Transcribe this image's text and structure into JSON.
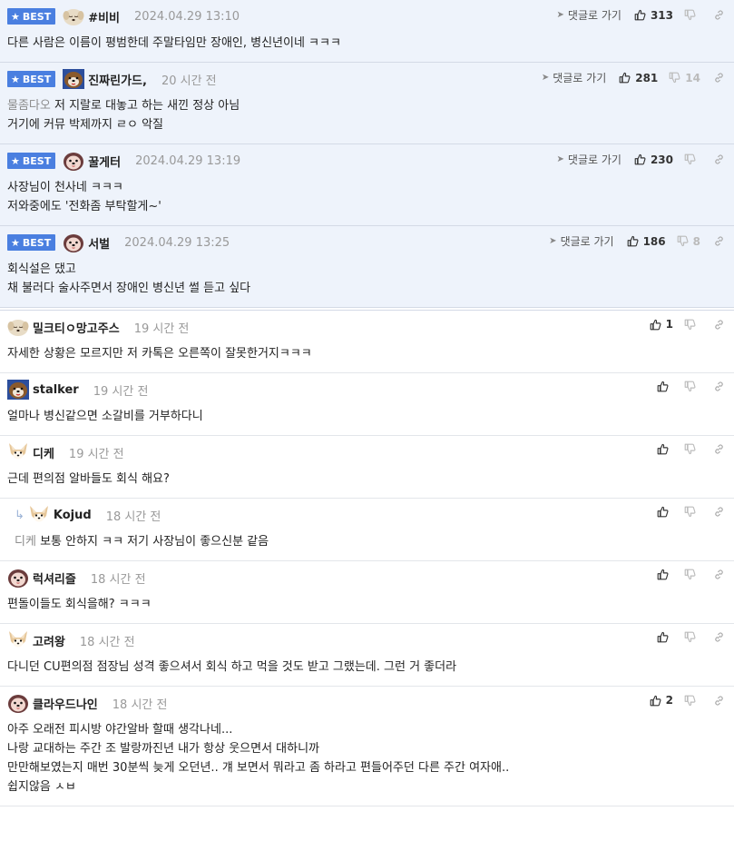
{
  "labels": {
    "best": "BEST",
    "go_reply": "댓글로 가기"
  },
  "colors": {
    "best_bg": "#eef3fb",
    "badge": "#4a7fe0"
  },
  "best_comments": [
    {
      "nick": "#비비",
      "time": "2024.04.29 13:10",
      "likes": "313",
      "dislikes": "",
      "avatar": "sleepy-dog",
      "lines": [
        "다른 사람은 이름이 평범한데 주말타임만 장애인, 병신년이네 ㅋㅋㅋ"
      ]
    },
    {
      "nick": "진짜린가드,",
      "time": "20 시간 전",
      "likes": "281",
      "dislikes": "14",
      "avatar": "brown-dog",
      "mention": "물좀다오",
      "lines": [
        "저 지랄로 대놓고 하는 새낀 정상 아님",
        "거기에 커뮤 박제까지 ㄹㅇ 악질"
      ]
    },
    {
      "nick": "꿀게터",
      "time": "2024.04.29 13:19",
      "likes": "230",
      "dislikes": "",
      "avatar": "pink-dog",
      "lines": [
        "사장님이 천사네 ㅋㅋㅋ",
        "저와중에도 '전화좀 부탁할게~'"
      ]
    },
    {
      "nick": "서벌",
      "time": "2024.04.29 13:25",
      "likes": "186",
      "dislikes": "8",
      "avatar": "pink-dog",
      "lines": [
        "회식설은 댔고",
        "채 불러다 술사주면서 장애인 병신년 썰 듣고 싶다"
      ]
    }
  ],
  "comments": [
    {
      "nick": "밀크티ㅇ망고주스",
      "time": "19 시간 전",
      "likes": "1",
      "avatar": "sleepy-dog",
      "lines": [
        "자세한 상황은 모르지만 저 카톡은 오른쪽이 잘못한거지ㅋㅋㅋ"
      ]
    },
    {
      "nick": "stalker",
      "time": "19 시간 전",
      "likes": "",
      "avatar": "brown-dog",
      "lines": [
        "얼마나 병신같으면 소갈비를 거부하다니"
      ]
    },
    {
      "nick": "디케",
      "time": "19 시간 전",
      "likes": "",
      "avatar": "fennec",
      "lines": [
        "근데 편의점 알바들도 회식 해요?"
      ]
    },
    {
      "nick": "Kojud",
      "time": "18 시간 전",
      "likes": "",
      "avatar": "fennec",
      "reply": true,
      "mention": "디케",
      "lines": [
        "보통 안하지 ㅋㅋ 저기 사장님이 좋으신분 같음"
      ]
    },
    {
      "nick": "럭셔리즐",
      "time": "18 시간 전",
      "likes": "",
      "avatar": "pink-dog",
      "lines": [
        "편돌이들도 회식을해? ㅋㅋㅋ"
      ]
    },
    {
      "nick": "고려왕",
      "time": "18 시간 전",
      "likes": "",
      "avatar": "fennec",
      "lines": [
        "다니던 CU편의점 점장님 성격 좋으셔서 회식 하고 먹을 것도 받고 그랬는데. 그런 거 좋더라"
      ]
    },
    {
      "nick": "클라우드나인",
      "time": "18 시간 전",
      "likes": "2",
      "avatar": "pink-dog",
      "lines": [
        "아주 오래전 피시방 야간알바 할때 생각나네...",
        "나랑 교대하는 주간 조 발랑까진년 내가 항상 웃으면서 대하니까",
        "만만해보였는지 매번 30분씩 늦게 오던년.. 걔 보면서 뭐라고 좀 하라고 편들어주던 다른 주간 여자애..",
        "쉽지않음 ㅅㅂ"
      ]
    }
  ]
}
